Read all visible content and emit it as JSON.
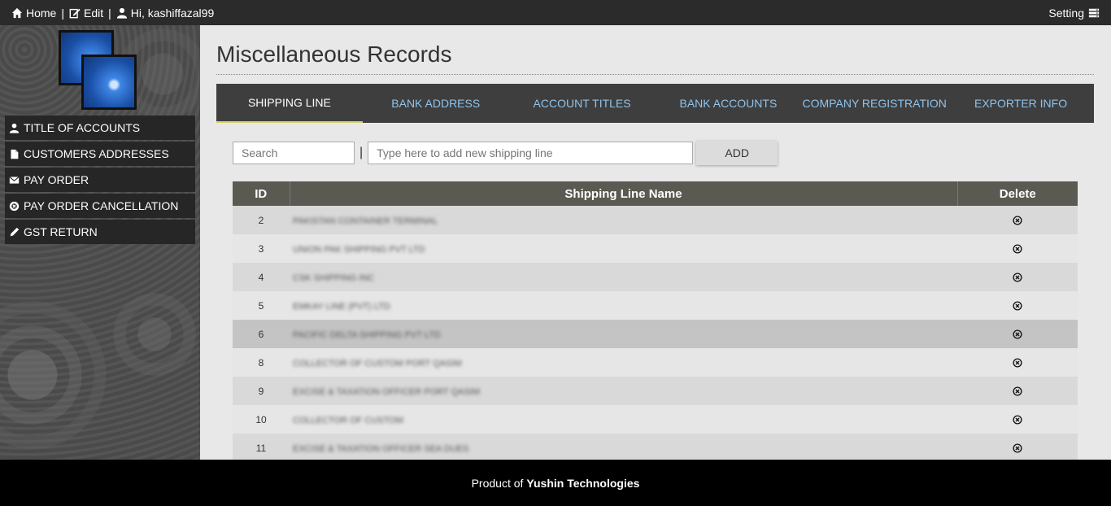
{
  "topbar": {
    "home": "Home",
    "edit": "Edit",
    "greeting": "Hi, kashiffazal99",
    "setting": "Setting"
  },
  "sidebar": {
    "items": [
      {
        "label": "TITLE OF ACCOUNTS",
        "icon": "user-icon"
      },
      {
        "label": "CUSTOMERS ADDRESSES",
        "icon": "file-icon"
      },
      {
        "label": "PAY ORDER",
        "icon": "envelope-icon"
      },
      {
        "label": "PAY ORDER CANCELLATION",
        "icon": "cancel-circle-icon"
      },
      {
        "label": "GST RETURN",
        "icon": "pencil-icon"
      }
    ]
  },
  "main": {
    "title": "Miscellaneous Records",
    "tabs": [
      {
        "label": "SHIPPING LINE",
        "active": true
      },
      {
        "label": "BANK ADDRESS",
        "active": false
      },
      {
        "label": "ACCOUNT TITLES",
        "active": false
      },
      {
        "label": "BANK ACCOUNTS",
        "active": false
      },
      {
        "label": "COMPANY REGISTRATION",
        "active": false
      },
      {
        "label": "EXPORTER INFO",
        "active": false
      }
    ],
    "search_placeholder": "Search",
    "separator": "|",
    "new_placeholder": "Type here to add new shipping line",
    "add_label": "ADD",
    "table": {
      "headers": [
        "ID",
        "Shipping Line Name",
        "Delete"
      ],
      "rows": [
        {
          "id": "2",
          "name": "PAKISTAN CONTAINER TERMINAL"
        },
        {
          "id": "3",
          "name": "UNION PAK SHIPPING PVT LTD"
        },
        {
          "id": "4",
          "name": "CSK SHIPPING INC"
        },
        {
          "id": "5",
          "name": "EMKAY LINE (PVT) LTD"
        },
        {
          "id": "6",
          "name": "PACIFIC DELTA SHIPPING PVT LTD"
        },
        {
          "id": "8",
          "name": "COLLECTOR OF CUSTOM PORT QASIM"
        },
        {
          "id": "9",
          "name": "EXCISE & TAXATION OFFICER PORT QASIM"
        },
        {
          "id": "10",
          "name": "COLLECTOR OF CUSTOM"
        },
        {
          "id": "11",
          "name": "EXCISE & TAXATION OFFICER SEA DUES"
        }
      ]
    }
  },
  "footer": {
    "prefix": "Product of",
    "company": "Yushin Technologies"
  },
  "colors": {
    "topbar": "#2b2b2b",
    "tab_bar": "#3e3e3e",
    "tab_text": "#8fc3ec",
    "tab_active_underline": "#d6cf6a",
    "table_header": "#5a5a52",
    "footer": "#000000"
  }
}
